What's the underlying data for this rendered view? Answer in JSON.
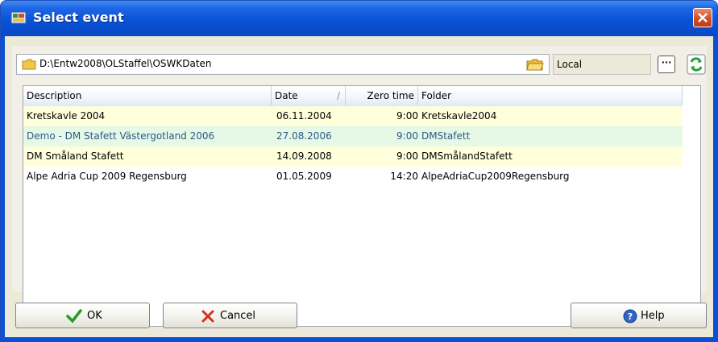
{
  "window": {
    "title": "Select event"
  },
  "toolbar": {
    "path": "D:\\Entw2008\\OLStaffel\\OSWKDaten",
    "location": "Local",
    "browse_label": "···"
  },
  "table": {
    "headers": {
      "description": "Description",
      "date": "Date",
      "sort_indicator": "/",
      "zero_time": "Zero time",
      "folder": "Folder"
    },
    "rows": [
      {
        "description": "Kretskavle 2004",
        "date": "06.11.2004",
        "zero_time": "9:00",
        "folder": "Kretskavle2004"
      },
      {
        "description": "Demo - DM Stafett Västergotland 2006",
        "date": "27.08.2006",
        "zero_time": "9:00",
        "folder": "DMStafett"
      },
      {
        "description": "DM Småland Stafett",
        "date": "14.09.2008",
        "zero_time": "9:00",
        "folder": "DMSmålandStafett"
      },
      {
        "description": "Alpe Adria Cup 2009 Regensburg",
        "date": "01.05.2009",
        "zero_time": "14:20",
        "folder": "AlpeAdriaCup2009Regensburg"
      }
    ]
  },
  "buttons": {
    "ok": "OK",
    "cancel": "Cancel",
    "help": "Help"
  },
  "colors": {
    "row_yellow": "#ffffdc",
    "row_green": "#e6f8e6",
    "row_green_text": "#2b5a8a",
    "title_blue": "#0a53d8"
  }
}
